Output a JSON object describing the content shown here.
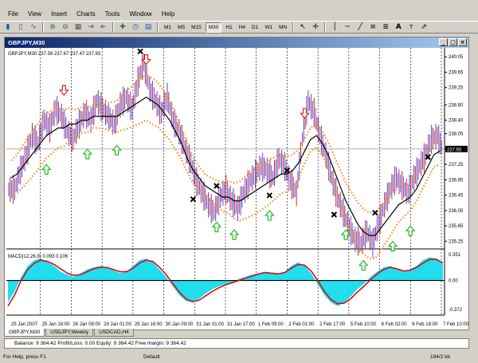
{
  "menu": [
    "File",
    "View",
    "Insert",
    "Charts",
    "Tools",
    "Window",
    "Help"
  ],
  "toolbar": {
    "timeframes": [
      "M1",
      "M5",
      "M15",
      "M30",
      "H1",
      "H4",
      "D1",
      "W1",
      "MN"
    ],
    "active_timeframe": "M30"
  },
  "window": {
    "title": "GBPJPY,M30"
  },
  "chart_data": {
    "type": "line",
    "symbol_label": "GBPJPY,M30  237.59 237.67 237.47 237.65",
    "current_price_label": "237.65",
    "price_axis_labels": [
      "240.05",
      "239.65",
      "239.25",
      "238.80",
      "238.40",
      "238.05",
      "237.65",
      "237.25",
      "236.85",
      "236.45",
      "236.05",
      "235.65",
      "235.25"
    ],
    "ylim": [
      235.05,
      240.2
    ],
    "time_axis_labels": [
      "25 Jan 2007",
      "25 Jan 16:00",
      "26 Jan 08:00",
      "29 Jan 01:00",
      "29 Jan 16:00",
      "30 Jan 09:00",
      "31 Jan 01:00",
      "31 Jan 17:00",
      "1 Feb 09:00",
      "2 Feb 01:00",
      "2 Feb 17:00",
      "5 Feb 10:00",
      "6 Feb 02:00",
      "6 Feb 18:00",
      "7 Feb 10:00"
    ],
    "close_series": [
      236.6,
      237.1,
      237.5,
      238.0,
      237.8,
      238.4,
      238.2,
      238.7,
      238.5,
      238.1,
      237.9,
      238.3,
      238.6,
      238.4,
      238.9,
      238.7,
      238.5,
      238.3,
      238.8,
      239.0,
      238.7,
      239.4,
      239.9,
      239.2,
      238.9,
      238.6,
      239.0,
      238.4,
      238.1,
      237.7,
      237.3,
      236.8,
      236.5,
      236.2,
      236.0,
      236.4,
      236.6,
      236.3,
      236.1,
      236.5,
      236.8,
      237.0,
      237.2,
      237.1,
      236.9,
      237.4,
      237.2,
      236.8,
      236.5,
      237.9,
      238.9,
      238.6,
      238.0,
      237.5,
      236.9,
      236.4,
      236.0,
      235.6,
      235.3,
      235.2,
      235.5,
      235.2,
      235.7,
      236.2,
      236.6,
      236.9,
      236.7,
      236.5,
      236.9,
      237.2,
      237.5,
      237.9,
      238.0,
      237.6
    ],
    "ma_series": [
      236.9,
      237.0,
      237.2,
      237.4,
      237.6,
      237.8,
      238.0,
      238.1,
      238.2,
      238.2,
      238.3,
      238.3,
      238.4,
      238.4,
      238.5,
      238.5,
      238.5,
      238.5,
      238.5,
      238.6,
      238.7,
      238.8,
      238.9,
      239.0,
      238.9,
      238.8,
      238.6,
      238.4,
      238.1,
      237.8,
      237.4,
      237.1,
      236.9,
      236.7,
      236.6,
      236.5,
      236.4,
      236.4,
      236.3,
      236.3,
      236.4,
      236.5,
      236.6,
      236.7,
      236.8,
      236.9,
      237.0,
      237.0,
      237.1,
      237.3,
      237.6,
      237.9,
      238.0,
      237.8,
      237.5,
      237.1,
      236.7,
      236.3,
      236.0,
      235.7,
      235.5,
      235.4,
      235.4,
      235.6,
      235.8,
      236.0,
      236.2,
      236.3,
      236.4,
      236.6,
      236.9,
      237.2,
      237.5,
      237.6
    ],
    "up_arrows": [
      6,
      13,
      18,
      35,
      38,
      44,
      57,
      60,
      65,
      68
    ],
    "down_arrows": [
      9,
      23,
      50
    ],
    "x_marks": [
      22,
      31,
      35,
      44,
      47,
      55,
      62,
      71
    ],
    "macd": {
      "label": "MACD(12,26,9) 0.093 0.106",
      "axis_labels": [
        "0.351",
        "0.00",
        "-0.372"
      ],
      "ylim": [
        -0.42,
        0.4
      ],
      "histogram": [
        -0.3,
        -0.15,
        0.05,
        0.2,
        0.28,
        0.3,
        0.25,
        0.2,
        0.12,
        0.08,
        0.05,
        0.1,
        0.15,
        0.18,
        0.2,
        0.18,
        0.14,
        0.1,
        0.12,
        0.2,
        0.28,
        0.3,
        0.25,
        0.15,
        0.05,
        -0.08,
        -0.2,
        -0.28,
        -0.3,
        -0.25,
        -0.18,
        -0.12,
        -0.08,
        -0.05,
        -0.02,
        0.02,
        0.05,
        0.08,
        0.1,
        0.12,
        0.1,
        0.08,
        0.12,
        0.2,
        0.25,
        0.2,
        0.1,
        -0.05,
        -0.2,
        -0.3,
        -0.35,
        -0.3,
        -0.22,
        -0.12,
        -0.05,
        0.05,
        0.12,
        0.18,
        0.2,
        0.15,
        0.12,
        0.15,
        0.2,
        0.28,
        0.32,
        0.3,
        0.22
      ],
      "signal": [
        -0.35,
        -0.2,
        0.0,
        0.15,
        0.24,
        0.28,
        0.26,
        0.22,
        0.16,
        0.1,
        0.07,
        0.08,
        0.12,
        0.16,
        0.18,
        0.18,
        0.15,
        0.12,
        0.12,
        0.17,
        0.24,
        0.28,
        0.26,
        0.18,
        0.08,
        -0.04,
        -0.16,
        -0.25,
        -0.29,
        -0.27,
        -0.21,
        -0.15,
        -0.1,
        -0.06,
        -0.03,
        0.0,
        0.03,
        0.06,
        0.09,
        0.11,
        0.1,
        0.09,
        0.11,
        0.17,
        0.22,
        0.21,
        0.13,
        0.0,
        -0.15,
        -0.26,
        -0.32,
        -0.31,
        -0.25,
        -0.16,
        -0.08,
        0.01,
        0.09,
        0.15,
        0.18,
        0.16,
        0.13,
        0.14,
        0.18,
        0.24,
        0.29,
        0.29,
        0.24
      ]
    }
  },
  "tabs": [
    "GBPJPY,M30",
    "USDJPY,Weekly",
    "USDCAD,H4"
  ],
  "active_tab": "GBPJPY,M30",
  "terminal": {
    "text": "Balance: 9 364.42  Profit/Loss: 0.00  Equity: 9 364.42  Free margin: 9 364.42"
  },
  "status": {
    "help": "For Help, press F1",
    "profile": "Default",
    "traffic": "194/2 kb"
  }
}
